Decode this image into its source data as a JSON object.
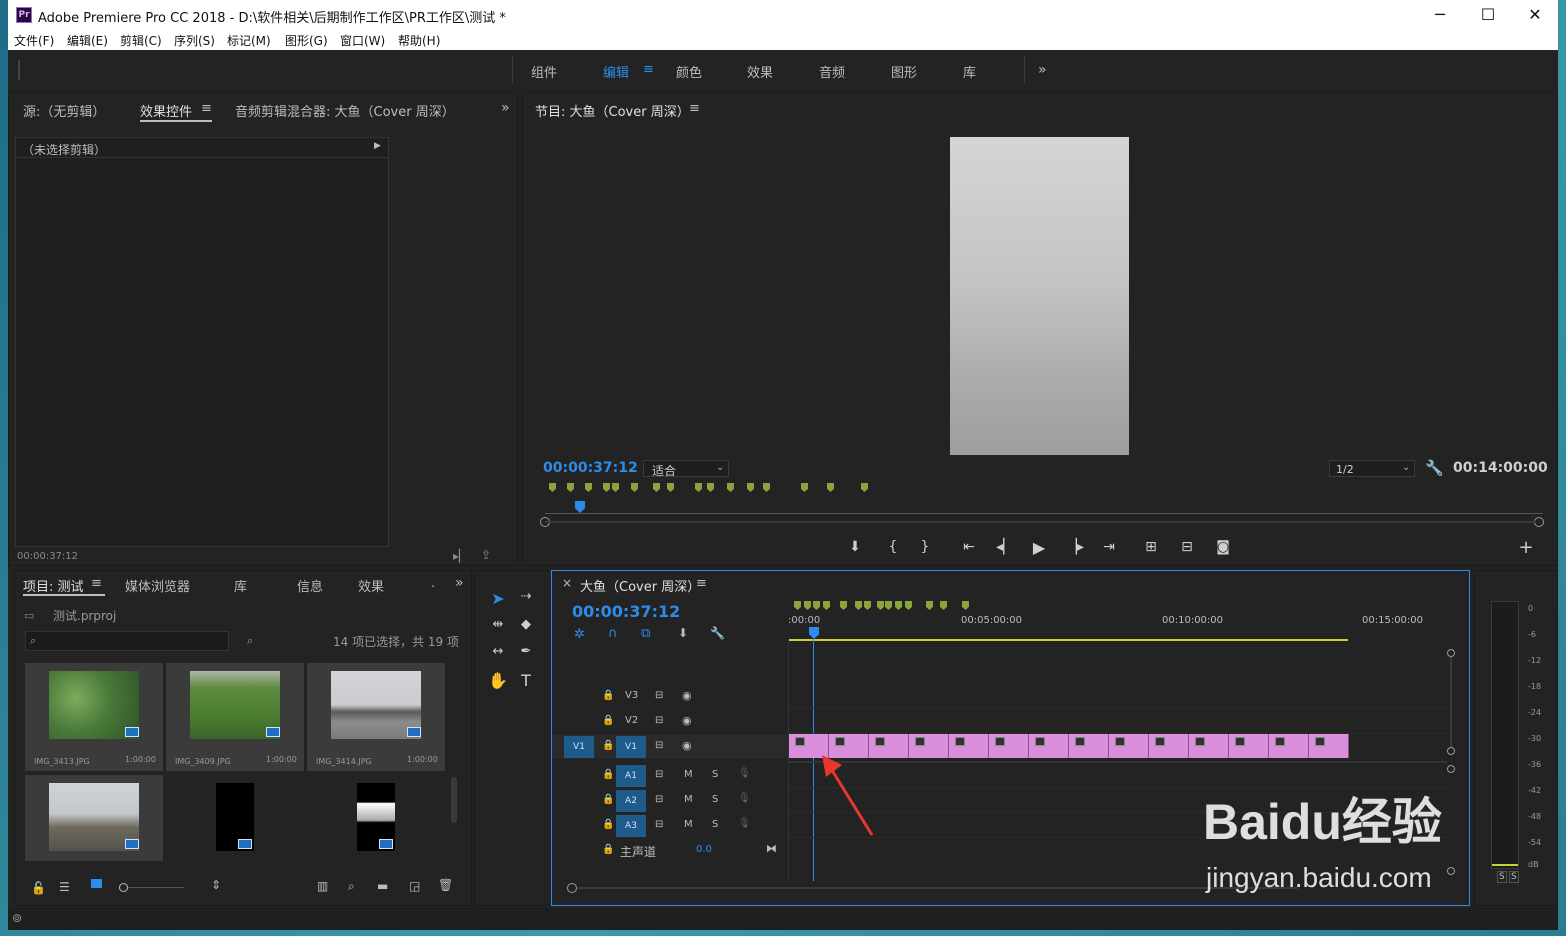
{
  "titlebar": {
    "title": "Adobe Premiere Pro CC 2018 - D:\\软件相关\\后期制作工作区\\PR工作区\\测试 *",
    "logo": "Pr",
    "minimize": "─",
    "maximize": "☐",
    "close": "✕"
  },
  "menu": [
    "文件(F)",
    "编辑(E)",
    "剪辑(C)",
    "序列(S)",
    "标记(M)",
    "图形(G)",
    "窗口(W)",
    "帮助(H)"
  ],
  "workspaces": [
    "组件",
    "编辑",
    "颜色",
    "效果",
    "音频",
    "图形",
    "库"
  ],
  "workspace_active": "编辑",
  "workspace_more": "»",
  "source_panel": {
    "tabs": [
      "源:（无剪辑）",
      "效果控件",
      "音频剪辑混合器: 大鱼（Cover 周深）"
    ],
    "active_tab": "效果控件",
    "no_clip": "（未选择剪辑）",
    "timecode": "00:00:37:12",
    "more": "»"
  },
  "program_panel": {
    "title": "节目: 大鱼（Cover 周深）",
    "timecode": "00:00:37:12",
    "fit": "适合",
    "resolution": "1/2",
    "duration": "00:14:00:00",
    "add": "+"
  },
  "project_panel": {
    "tabs": [
      "项目: 测试",
      "媒体浏览器",
      "库",
      "信息",
      "效果",
      "ㆍ"
    ],
    "more": "»",
    "file": "测试.prproj",
    "selection": "14 项已选择，共 19 项",
    "items": [
      {
        "name": "IMG_3413.JPG",
        "dur": "1:00:00"
      },
      {
        "name": "IMG_3409.JPG",
        "dur": "1:00:00"
      },
      {
        "name": "IMG_3414.JPG",
        "dur": "1:00:00"
      },
      {
        "name": "",
        "dur": ""
      },
      {
        "name": "",
        "dur": ""
      },
      {
        "name": "",
        "dur": ""
      }
    ]
  },
  "timeline": {
    "title": "大鱼（Cover 周深）",
    "close": "×",
    "timecode": "00:00:37:12",
    "ruler": [
      ":00:00",
      "00:05:00:00",
      "00:10:00:00",
      "00:15:00:00"
    ],
    "video_tracks": [
      "V3",
      "V2",
      "V1"
    ],
    "audio_tracks": [
      "A1",
      "A2",
      "A3"
    ],
    "source_patch": "V1",
    "master": "主声道",
    "master_value": "0.0",
    "mute": "M",
    "solo": "S"
  },
  "meter": {
    "scale": [
      "0",
      "-6",
      "-12",
      "-18",
      "-24",
      "-30",
      "-36",
      "-42",
      "-48",
      "-54",
      "dB"
    ],
    "solo_left": "S",
    "solo_right": "S"
  },
  "watermark": {
    "line1": "Baidu经验",
    "line2": "jingyan.baidu.com"
  },
  "colors": {
    "accent": "#2d8ceb",
    "clip": "#d98fdc",
    "marker": "#8aa33a",
    "panel": "#232323"
  }
}
